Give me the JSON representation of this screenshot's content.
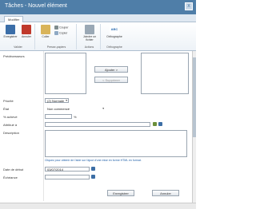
{
  "window": {
    "title": "Tâches - Nouvel élément",
    "close_glyph": "x"
  },
  "tabs": [
    {
      "label": "Modifier"
    }
  ],
  "ribbon": {
    "save_label": "Enregistrer",
    "cancel_label": "Annuler",
    "paste_label": "Coller",
    "cut_label": "Couper",
    "copy_label": "Copier",
    "attach_label": "Joindre un fichier",
    "spelling_label": "Orthographe",
    "spelling_icon_text": "ABC",
    "groups": {
      "validate": "Valider",
      "clipboard": "Presse-papiers",
      "actions": "Actions",
      "spelling": "Orthographe"
    }
  },
  "form": {
    "predecessors_label": "Prédécesseurs",
    "add_button": "Ajouter >",
    "remove_button": "< Supprimer",
    "priority_label": "Priorité",
    "priority_value": "(2) Normale",
    "status_label": "État",
    "status_value": "Non commencé",
    "percent_label": "% achevé",
    "percent_suffix": "%",
    "assigned_label": "Attribué à",
    "description_label": "Description",
    "description_hint": "Cliquez pour obtenir de l'aide sur l'ajout d'une mise en forme HTML en format.",
    "start_label": "Date de début",
    "start_value": "03/07/2014",
    "due_label": "Échéance",
    "save_button": "Enregistrer",
    "cancel_button": "Annuler"
  },
  "colors": {
    "titlebar": "#4f7ea8",
    "link": "#1f5fa8",
    "calendar_icon": "#3c6ea5"
  },
  "icons": [
    "close-icon",
    "save-icon",
    "cancel-icon",
    "paste-icon",
    "cut-icon",
    "copy-icon",
    "attach-icon",
    "spelling-icon",
    "people-picker-icon",
    "address-book-icon",
    "calendar-icon"
  ]
}
